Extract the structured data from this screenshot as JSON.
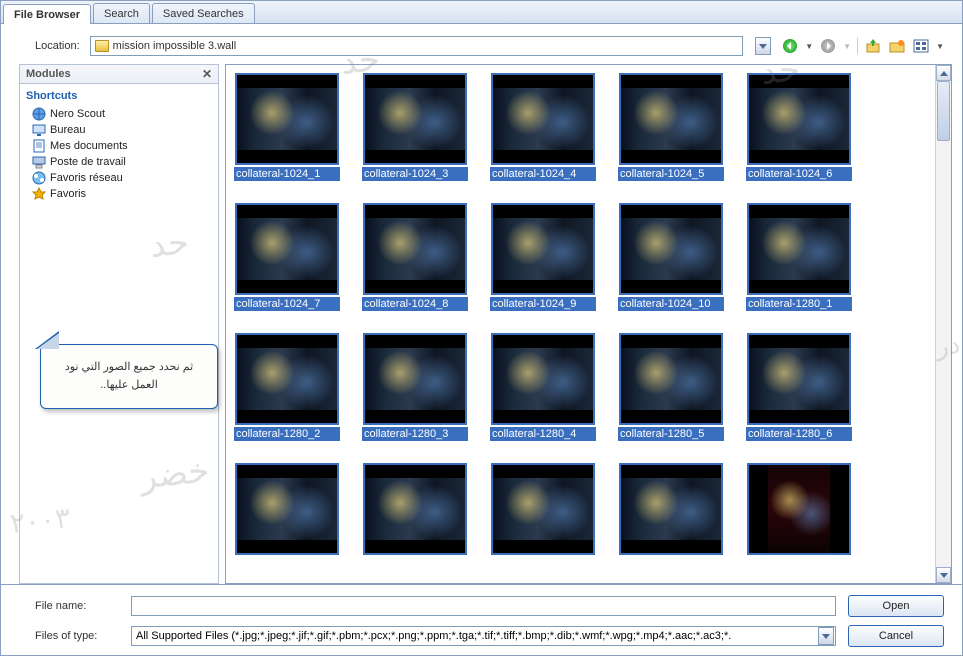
{
  "tabs": {
    "file_browser": "File Browser",
    "search": "Search",
    "saved_searches": "Saved Searches"
  },
  "location": {
    "label": "Location:",
    "value": "mission impossible 3.wall"
  },
  "sidebar": {
    "header": "Modules",
    "shortcuts_label": "Shortcuts",
    "items": [
      {
        "label": "Nero Scout",
        "icon": "globe"
      },
      {
        "label": "Bureau",
        "icon": "desktop"
      },
      {
        "label": "Mes documents",
        "icon": "doc"
      },
      {
        "label": "Poste de travail",
        "icon": "computer"
      },
      {
        "label": "Favoris réseau",
        "icon": "network"
      },
      {
        "label": "Favoris",
        "icon": "star"
      }
    ]
  },
  "callout": "ثم نحدد جميع الصور التي نود العمل عليها..",
  "thumbnails": [
    {
      "name": "collateral-1024_1"
    },
    {
      "name": "collateral-1024_3"
    },
    {
      "name": "collateral-1024_4"
    },
    {
      "name": "collateral-1024_5"
    },
    {
      "name": "collateral-1024_6"
    },
    {
      "name": "collateral-1024_7"
    },
    {
      "name": "collateral-1024_8"
    },
    {
      "name": "collateral-1024_9"
    },
    {
      "name": "collateral-1024_10"
    },
    {
      "name": "collateral-1280_1"
    },
    {
      "name": "collateral-1280_2"
    },
    {
      "name": "collateral-1280_3"
    },
    {
      "name": "collateral-1280_4"
    },
    {
      "name": "collateral-1280_5"
    },
    {
      "name": "collateral-1280_6"
    },
    {
      "name": ""
    },
    {
      "name": ""
    },
    {
      "name": ""
    },
    {
      "name": ""
    },
    {
      "name": "",
      "portrait": true
    }
  ],
  "bottom": {
    "file_name_label": "File name:",
    "file_name_value": "",
    "files_type_label": "Files of type:",
    "files_type_value": "All Supported Files (*.jpg;*.jpeg;*.jif;*.gif;*.pbm;*.pcx;*.png;*.ppm;*.tga;*.tif;*.tiff;*.bmp;*.dib;*.wmf;*.wpg;*.mp4;*.aac;*.ac3;*.",
    "open": "Open",
    "cancel": "Cancel"
  }
}
